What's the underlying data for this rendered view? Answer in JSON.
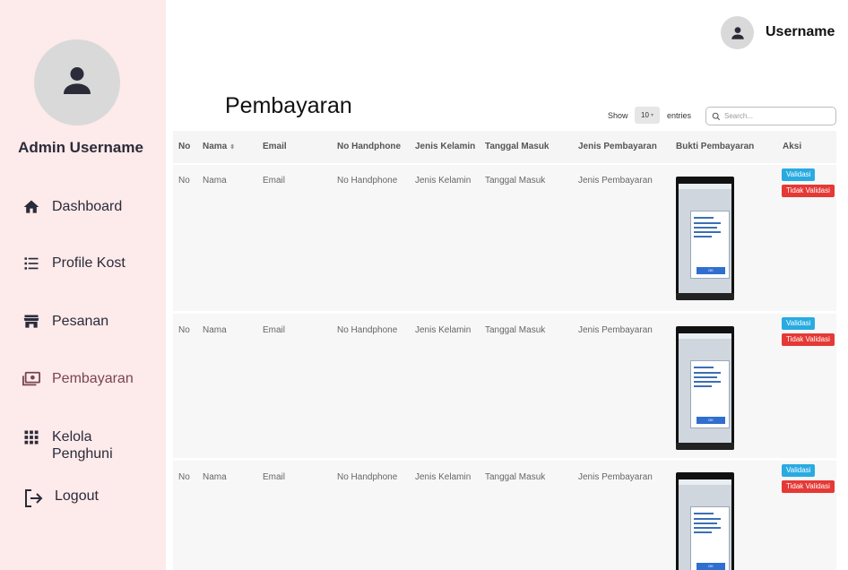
{
  "sidebar": {
    "admin_name": "Admin Username",
    "nav": [
      {
        "label": "Dashboard",
        "icon": "home-icon"
      },
      {
        "label": "Profile Kost",
        "icon": "list-icon"
      },
      {
        "label": "Pesanan",
        "icon": "store-icon"
      },
      {
        "label": "Pembayaran",
        "icon": "payment-icon",
        "active": true
      },
      {
        "label": "Kelola Penghuni",
        "icon": "grid-icon"
      },
      {
        "label": "Logout",
        "icon": "logout-icon"
      }
    ]
  },
  "topbar": {
    "username": "Username"
  },
  "page": {
    "title": "Pembayaran",
    "show_label": "Show",
    "entries_value": "10",
    "entries_label": "entries",
    "search_placeholder": "Search..."
  },
  "table": {
    "headers": [
      "No",
      "Nama",
      "Email",
      "No Handphone",
      "Jenis Kelamin",
      "Tanggal Masuk",
      "Jenis Pembayaran",
      "Bukti Pembayaran",
      "Aksi"
    ],
    "rows": [
      {
        "no": "No",
        "nama": "Nama",
        "email": "Email",
        "hp": "No Handphone",
        "jk": "Jenis Kelamin",
        "tgl": "Tanggal Masuk",
        "jp": "Jenis Pembayaran",
        "validasi": "Validasi",
        "tidak": "Tidak Validasi"
      },
      {
        "no": "No",
        "nama": "Nama",
        "email": "Email",
        "hp": "No Handphone",
        "jk": "Jenis Kelamin",
        "tgl": "Tanggal Masuk",
        "jp": "Jenis Pembayaran",
        "validasi": "Validasi",
        "tidak": "Tidak Validasi"
      },
      {
        "no": "No",
        "nama": "Nama",
        "email": "Email",
        "hp": "No Handphone",
        "jk": "Jenis Kelamin",
        "tgl": "Tanggal Masuk",
        "jp": "Jenis Pembayaran",
        "validasi": "Validasi",
        "tidak": "Tidak Validasi"
      }
    ]
  },
  "colors": {
    "sidebar_bg": "#fdeaea",
    "validasi": "#29abe2",
    "tidak_validasi": "#e53935",
    "active_nav": "#7a4550"
  }
}
